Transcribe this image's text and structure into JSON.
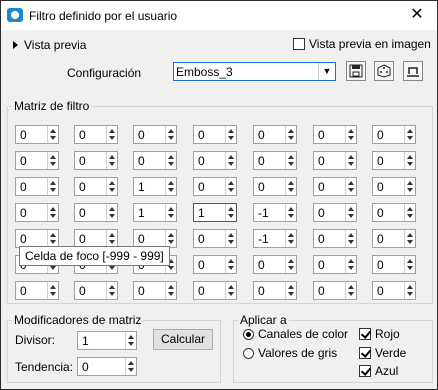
{
  "window": {
    "title": "Filtro definido por el usuario",
    "close_glyph": "✕"
  },
  "preview": {
    "toggle_label": "Vista previa",
    "image_label": "Vista previa en imagen",
    "image_checked": false
  },
  "config": {
    "label": "Configuración",
    "value": "Emboss_3"
  },
  "matrix": {
    "legend": "Matriz de filtro",
    "rows": [
      [
        "0",
        "0",
        "0",
        "0",
        "0",
        "0",
        "0"
      ],
      [
        "0",
        "0",
        "0",
        "0",
        "0",
        "0",
        "0"
      ],
      [
        "0",
        "0",
        "1",
        "0",
        "0",
        "0",
        "0"
      ],
      [
        "0",
        "0",
        "1",
        "1",
        "-1",
        "0",
        "0"
      ],
      [
        "0",
        "0",
        "0",
        "0",
        "-1",
        "0",
        "0"
      ],
      [
        "0",
        "0",
        "0",
        "0",
        "0",
        "0",
        "0"
      ],
      [
        "0",
        "0",
        "0",
        "0",
        "0",
        "0",
        "0"
      ]
    ],
    "focus_row": 3,
    "focus_col": 3,
    "tooltip": "Celda de foco [-999 - 999]"
  },
  "modifiers": {
    "legend": "Modificadores de matriz",
    "divisor_label": "Divisor:",
    "divisor_value": "1",
    "tendencia_label": "Tendencia:",
    "tendencia_value": "0",
    "calc_label": "Calcular"
  },
  "apply": {
    "legend": "Aplicar a",
    "radios": [
      {
        "label": "Canales de color",
        "checked": true
      },
      {
        "label": "Valores de gris",
        "checked": false
      }
    ],
    "channels": [
      {
        "label": "Rojo",
        "checked": true
      },
      {
        "label": "Verde",
        "checked": true
      },
      {
        "label": "Azul",
        "checked": true
      }
    ]
  }
}
